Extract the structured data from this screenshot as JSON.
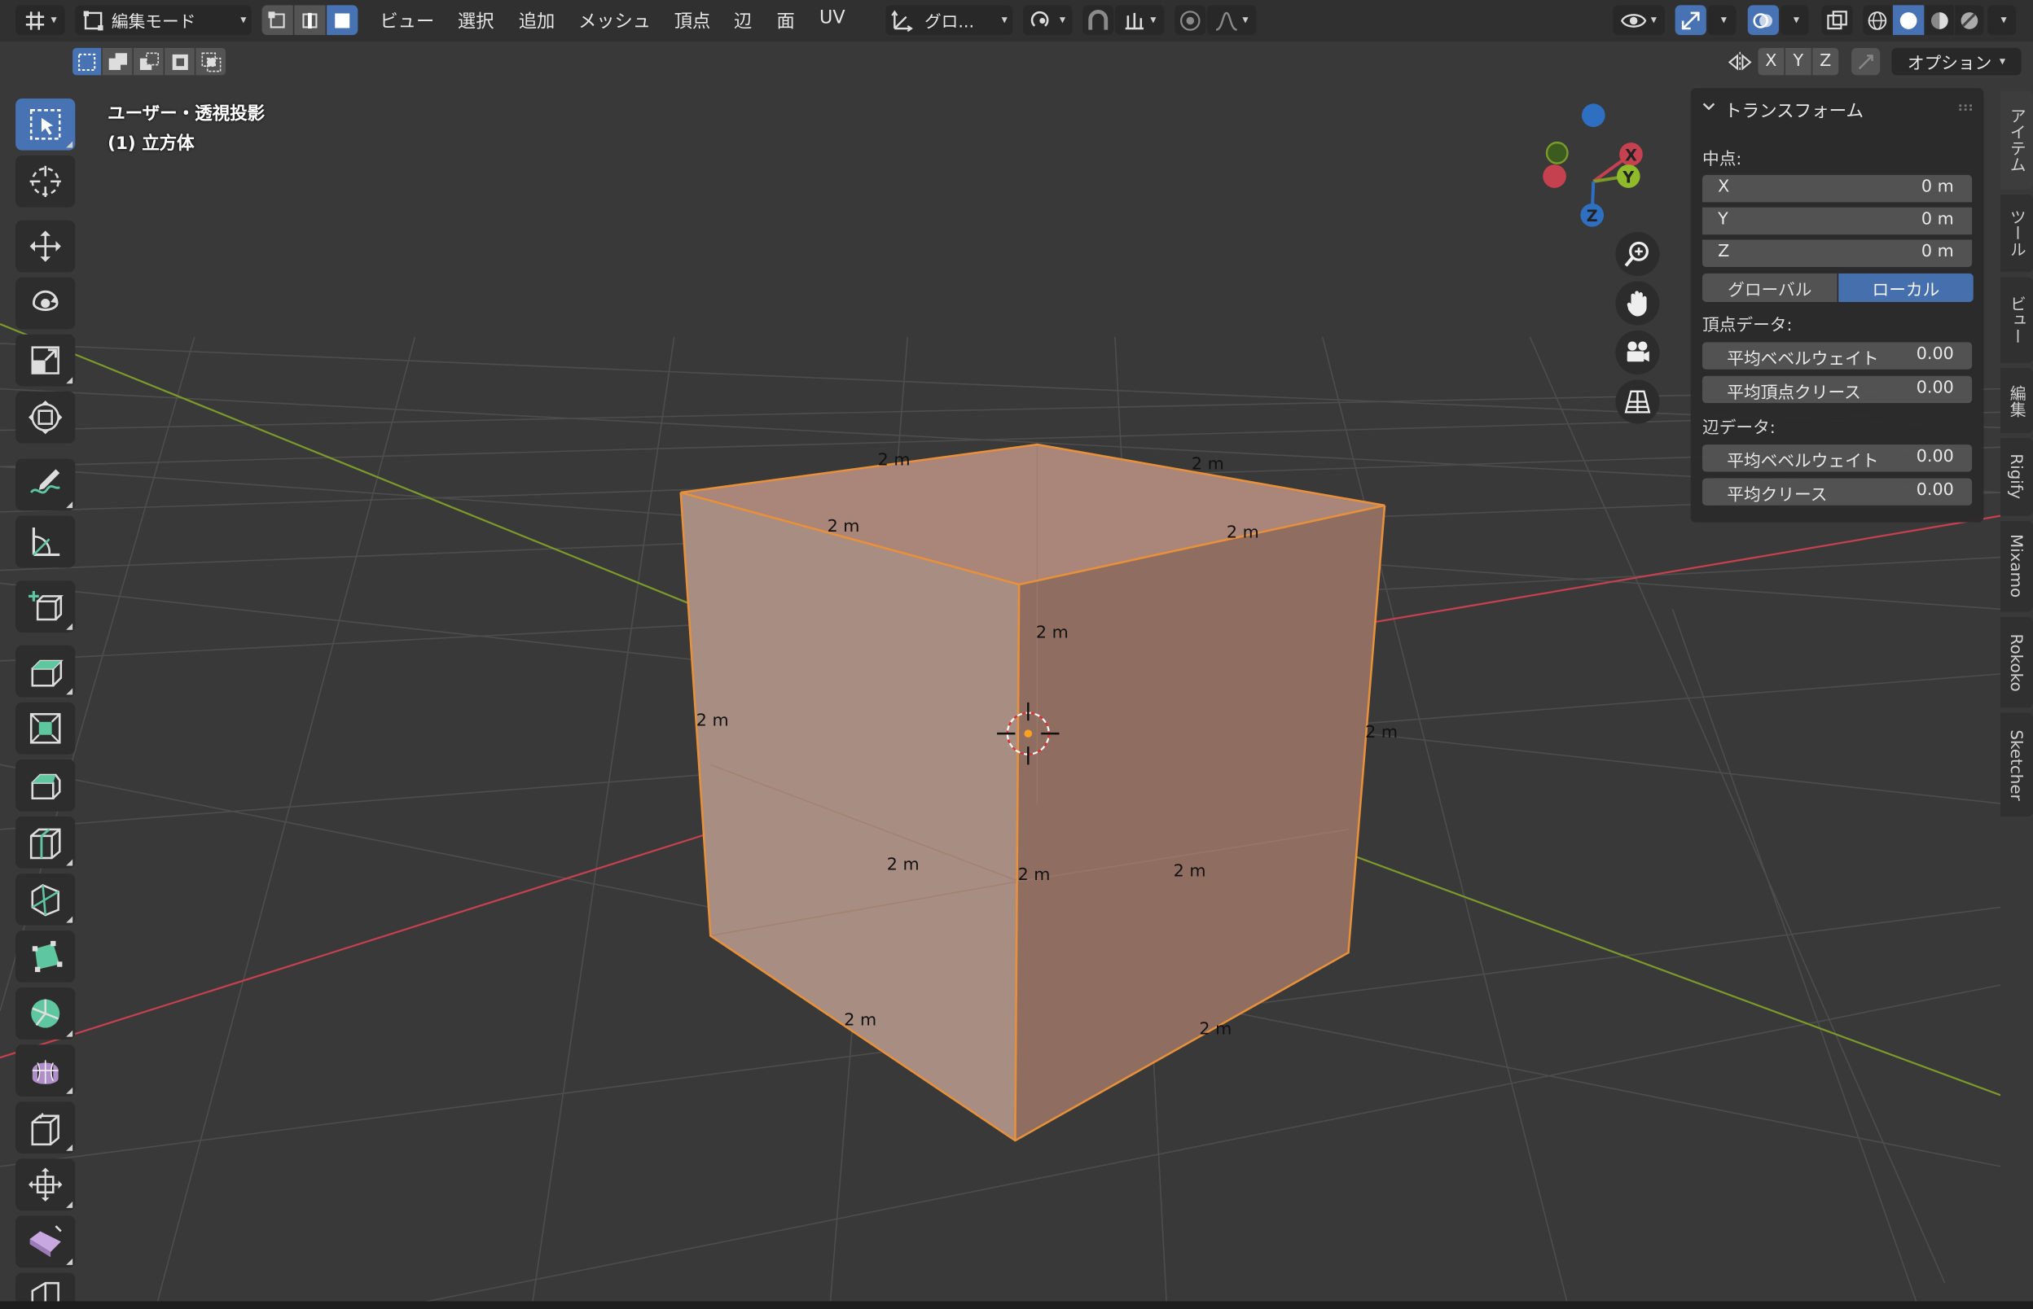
{
  "header": {
    "mode_label": "編集モード",
    "menus": [
      "ビュー",
      "選択",
      "追加",
      "メッシュ",
      "頂点",
      "辺",
      "面",
      "UV"
    ],
    "transform_orientation": "グロ...",
    "axis_labels": [
      "X",
      "Y",
      "Z"
    ],
    "options_label": "オプション"
  },
  "viewport": {
    "view_name": "ユーザー・透視投影",
    "object_name": "(1) 立方体",
    "edge_length_label": "2 m"
  },
  "gizmo": {
    "x": "X",
    "y": "Y",
    "z": "Z"
  },
  "npanel": {
    "title": "トランスフォーム",
    "median_label": "中点:",
    "fields": [
      {
        "label": "X",
        "value": "0 m"
      },
      {
        "label": "Y",
        "value": "0 m"
      },
      {
        "label": "Z",
        "value": "0 m"
      }
    ],
    "global_label": "グローバル",
    "local_label": "ローカル",
    "vertex_data_label": "頂点データ:",
    "vertex_bevel_label": "平均ベベルウェイト",
    "vertex_bevel_value": "0.00",
    "vertex_crease_label": "平均頂点クリース",
    "vertex_crease_value": "0.00",
    "edge_data_label": "辺データ:",
    "edge_bevel_label": "平均ベベルウェイト",
    "edge_bevel_value": "0.00",
    "edge_crease_label": "平均クリース",
    "edge_crease_value": "0.00"
  },
  "side_tabs": [
    "アイテム",
    "ツール",
    "ビュー",
    "編集",
    "Rigify",
    "Mixamo",
    "Rokoko",
    "Sketcher"
  ],
  "colors": {
    "accent": "#4772b3",
    "selection": "#e8903a",
    "axis_x": "#c64150",
    "axis_y": "#7c9a2a",
    "axis_z": "#2f6fc1"
  }
}
